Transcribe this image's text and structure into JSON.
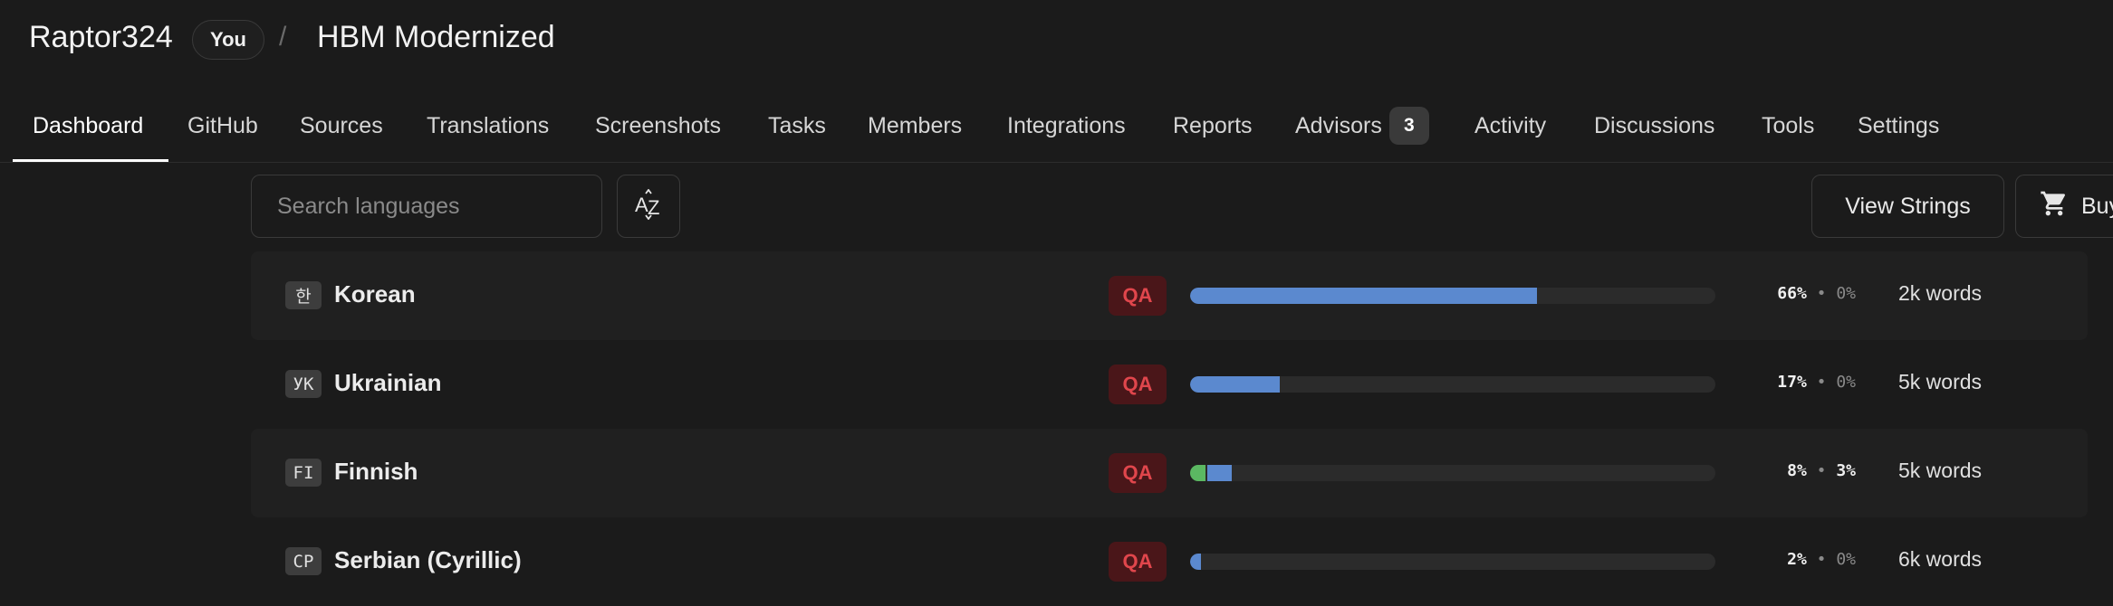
{
  "header": {
    "owner": "Raptor324",
    "owner_badge": "You",
    "separator": "/",
    "project": "HBM Modernized"
  },
  "tabs": [
    {
      "label": "Dashboard",
      "active": true
    },
    {
      "label": "GitHub"
    },
    {
      "label": "Sources"
    },
    {
      "label": "Translations"
    },
    {
      "label": "Screenshots"
    },
    {
      "label": "Tasks"
    },
    {
      "label": "Members"
    },
    {
      "label": "Integrations"
    },
    {
      "label": "Reports"
    },
    {
      "label": "Advisors",
      "count": "3"
    },
    {
      "label": "Activity"
    },
    {
      "label": "Discussions"
    },
    {
      "label": "Tools"
    },
    {
      "label": "Settings"
    }
  ],
  "toolbar": {
    "search_placeholder": "Search languages",
    "sort_icon": "sort-az-icon",
    "view_strings_label": "View Strings",
    "buy_label": "Buy",
    "buy_icon": "shopping-cart-icon"
  },
  "languages": [
    {
      "code": "한",
      "name": "Korean",
      "qa": "QA",
      "translated": 66,
      "approved": 0,
      "translated_label": "66%",
      "approved_label": "0%",
      "words": "2k words"
    },
    {
      "code": "УК",
      "name": "Ukrainian",
      "qa": "QA",
      "translated": 17,
      "approved": 0,
      "translated_label": "17%",
      "approved_label": "0%",
      "words": "5k words"
    },
    {
      "code": "FI",
      "name": "Finnish",
      "qa": "QA",
      "translated": 8,
      "approved": 3,
      "translated_label": "8%",
      "approved_label": "3%",
      "words": "5k words"
    },
    {
      "code": "CP",
      "name": "Serbian (Cyrillic)",
      "qa": "QA",
      "translated": 2,
      "approved": 0,
      "translated_label": "2%",
      "approved_label": "0%",
      "words": "6k words"
    }
  ],
  "colors": {
    "background": "#1b1b1b",
    "translated_bar": "#5b89cf",
    "approved_bar": "#5bb862",
    "qa_text": "#e0464c",
    "qa_bg": "#4a1619"
  }
}
